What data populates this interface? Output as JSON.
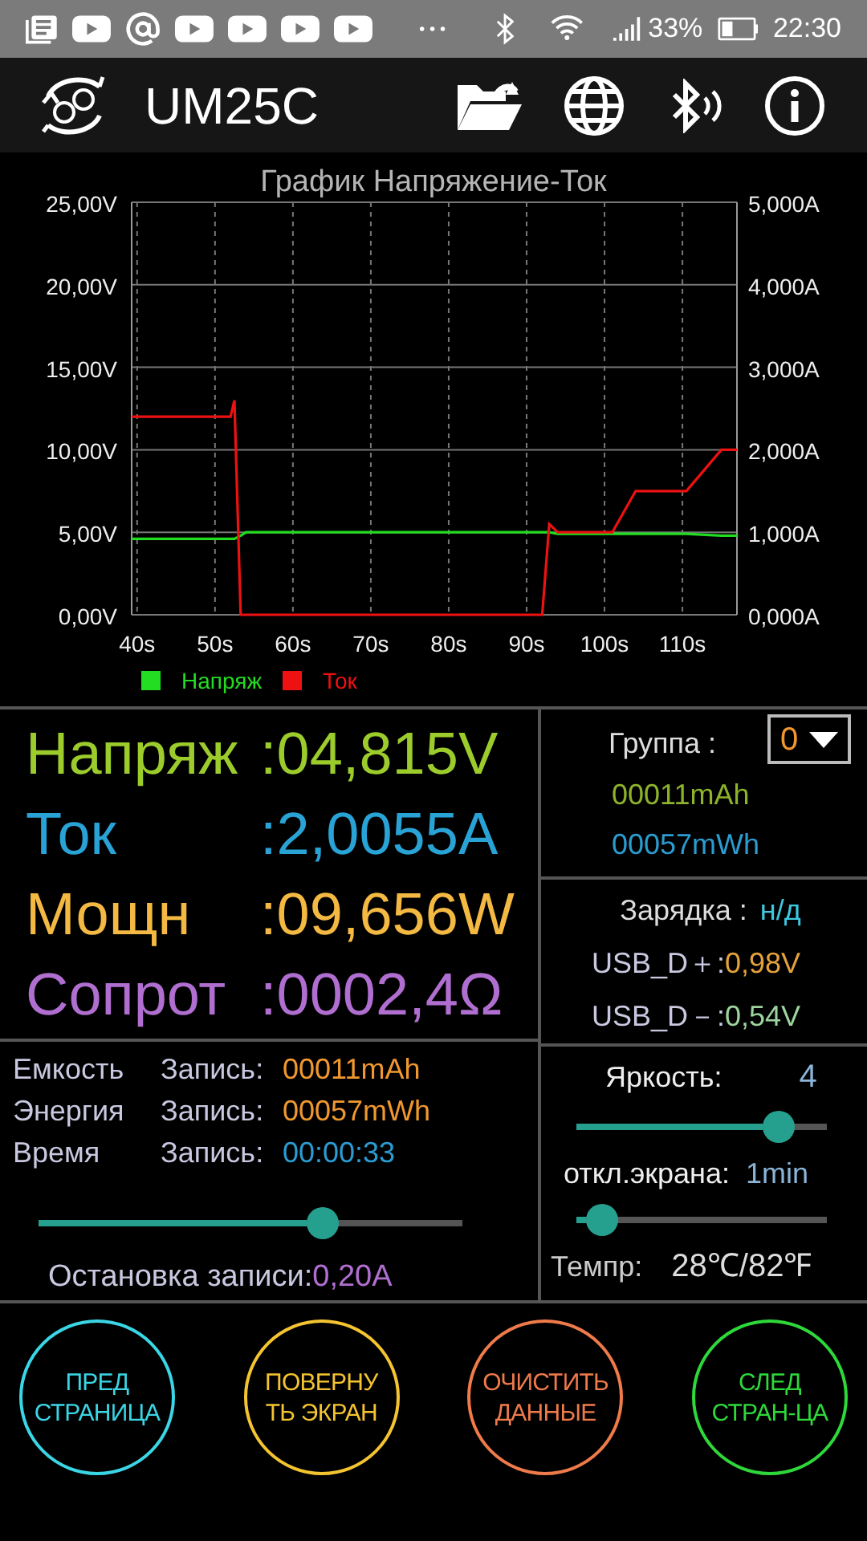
{
  "status_bar": {
    "battery": "33%",
    "time": "22:30"
  },
  "app_bar": {
    "title": "UM25C"
  },
  "chart": {
    "chart_data": {
      "type": "line",
      "title": "График Напряжение-Ток",
      "x": [
        39.3,
        52,
        52.5,
        53.3,
        54,
        92,
        92.9,
        94,
        101,
        104,
        110.5,
        115,
        117
      ],
      "series": [
        {
          "name": "Напряж",
          "color": "#22dd22",
          "axis": "y",
          "values": [
            4.6,
            4.6,
            4.6,
            4.8,
            5.0,
            5.0,
            5.0,
            4.9,
            4.9,
            4.9,
            4.9,
            4.8,
            4.8
          ]
        },
        {
          "name": "Ток",
          "color": "#ee1111",
          "axis": "y2",
          "values": [
            2.4,
            2.4,
            2.6,
            0,
            0,
            0,
            1.1,
            1.0,
            1.0,
            1.5,
            1.5,
            2.0,
            2.0
          ]
        }
      ],
      "grid": true,
      "legend": true,
      "xlim": [
        39.3,
        117
      ],
      "ylim": [
        0,
        25
      ],
      "y2lim": [
        0,
        5
      ],
      "xticks": [
        {
          "value": 40,
          "label": "40s"
        },
        {
          "value": 50,
          "label": "50s"
        },
        {
          "value": 60,
          "label": "60s"
        },
        {
          "value": 70,
          "label": "70s"
        },
        {
          "value": 80,
          "label": "80s"
        },
        {
          "value": 90,
          "label": "90s"
        },
        {
          "value": 100,
          "label": "100s"
        },
        {
          "value": 110,
          "label": "110s"
        }
      ],
      "yticks": [
        {
          "value": 0,
          "label": "0,00V"
        },
        {
          "value": 5,
          "label": "5,00V"
        },
        {
          "value": 10,
          "label": "10,00V"
        },
        {
          "value": 15,
          "label": "15,00V"
        },
        {
          "value": 20,
          "label": "20,00V"
        },
        {
          "value": 25,
          "label": "25,00V"
        }
      ],
      "y2ticks": [
        {
          "value": 0,
          "label": "0,000A"
        },
        {
          "value": 1,
          "label": "1,000A"
        },
        {
          "value": 2,
          "label": "2,000A"
        },
        {
          "value": 3,
          "label": "3,000A"
        },
        {
          "value": 4,
          "label": "4,000A"
        },
        {
          "value": 5,
          "label": "5,000A"
        }
      ]
    }
  },
  "readings": [
    {
      "label": "Напряж",
      "value": ":04,815V",
      "color": "#9ccc2c"
    },
    {
      "label": "Ток",
      "value": ":2,0055A",
      "color": "#29a3d6"
    },
    {
      "label": "Мощн",
      "value": ":09,656W",
      "color": "#f4b942"
    },
    {
      "label": "Сопрот",
      "value": ":0002,4Ω",
      "color": "#b06fd0"
    }
  ],
  "group": {
    "label": "Группа :",
    "value": "0",
    "capacity": "00011mAh",
    "energy": "00057mWh"
  },
  "charging": {
    "label": "Зарядка :",
    "value": "н/д",
    "dplus_label": "USB_D＋:",
    "dplus_value": "0,98V",
    "dminus_label": "USB_D－:",
    "dminus_value": "0,54V"
  },
  "records": [
    {
      "name": "Емкость",
      "label": "Запись:",
      "value": "00011mAh",
      "color": "#f0982e"
    },
    {
      "name": "Энергия",
      "label": "Запись:",
      "value": "00057mWh",
      "color": "#f0982e"
    },
    {
      "name": "Время",
      "label": "Запись:",
      "value": "00:00:33",
      "color": "#2b9bd0"
    }
  ],
  "stop_slider": {
    "level": 0.67,
    "label": "Остановка записи:",
    "value": "0,20A"
  },
  "brightness": {
    "label": "Яркость:",
    "value": "4",
    "level": 0.81
  },
  "screen_off": {
    "label": "откл.экрана:",
    "value": "1min",
    "level": 0.1
  },
  "temperature": {
    "label": "Темпр:",
    "value": "28℃/82℉"
  },
  "buttons": [
    {
      "lines": [
        "ПРЕД",
        "СТРАНИЦА"
      ],
      "color": "#3ad6e6"
    },
    {
      "lines": [
        "ПОВЕРНУ",
        "ТЬ ЭКРАН"
      ],
      "color": "#f4c430"
    },
    {
      "lines": [
        "ОЧИСТИТЬ",
        "ДАННЫЕ"
      ],
      "color": "#ef7a4a"
    },
    {
      "lines": [
        "СЛЕД",
        "СТРАН-ЦА"
      ],
      "color": "#2ed83a"
    }
  ]
}
